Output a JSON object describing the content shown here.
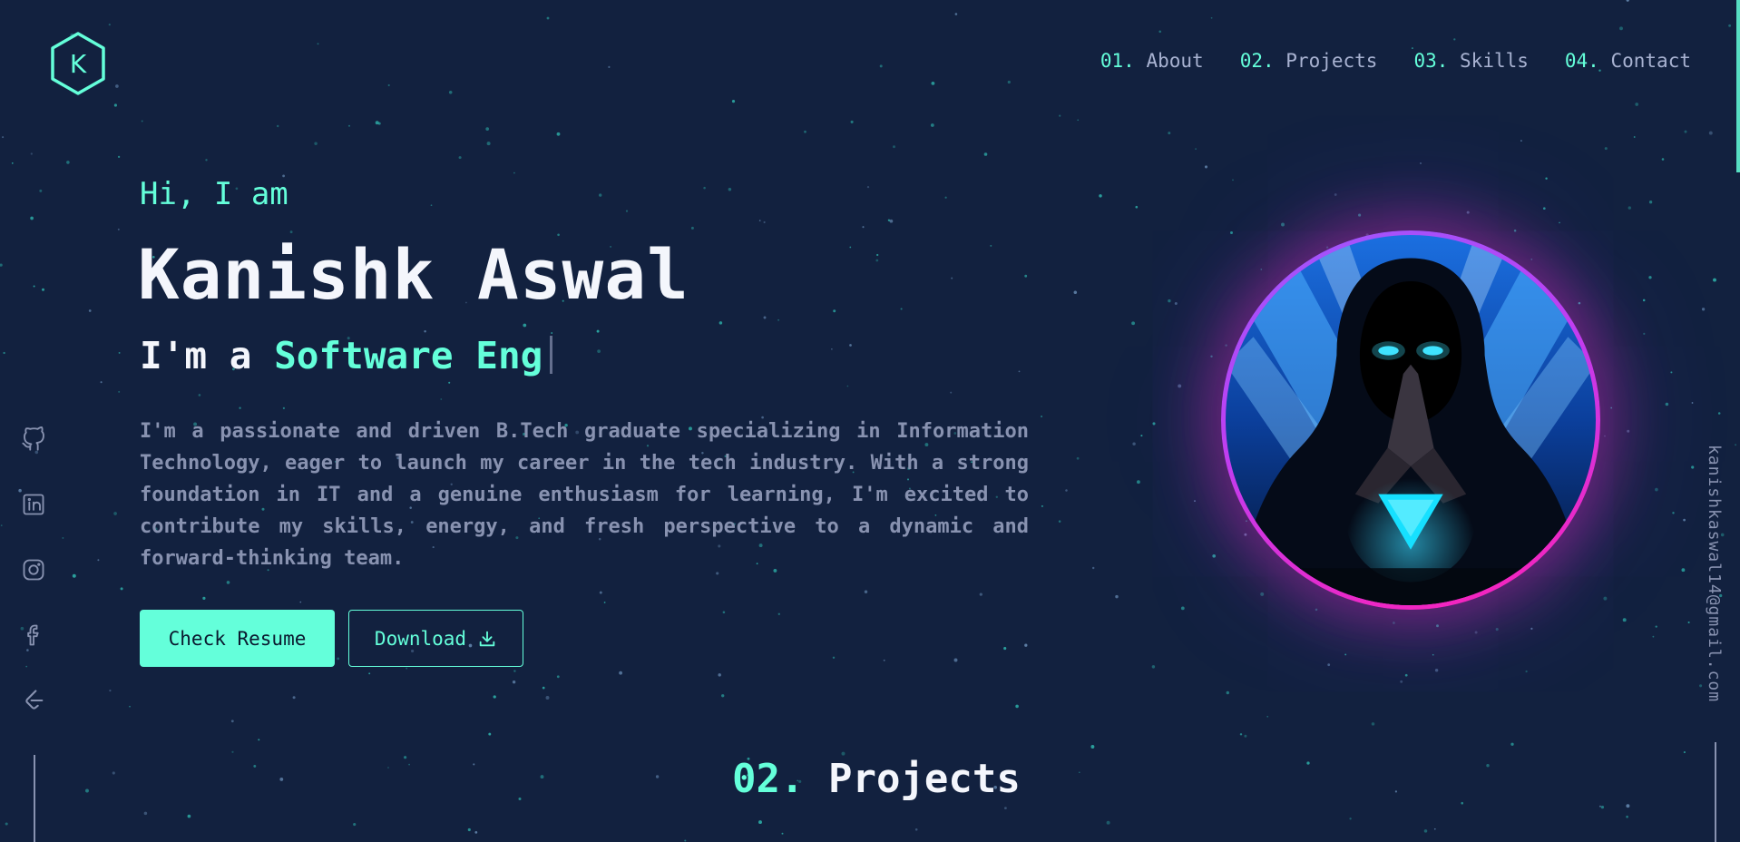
{
  "logo": {
    "letter": "K"
  },
  "nav": {
    "items": [
      {
        "num": "01.",
        "label": "About"
      },
      {
        "num": "02.",
        "label": "Projects"
      },
      {
        "num": "03.",
        "label": "Skills"
      },
      {
        "num": "04.",
        "label": "Contact"
      }
    ]
  },
  "hero": {
    "greeting": "Hi, I am",
    "name": "Kanishk Aswal",
    "role_prefix": "I'm a ",
    "role_typed": "Software Eng",
    "bio": "I'm a passionate and driven B.Tech graduate specializing in Information Technology, eager to launch my career in the tech industry. With a strong foundation in IT and a genuine enthusiasm for learning, I'm excited to contribute my skills, energy, and fresh perspective to a dynamic and forward-thinking team.",
    "primary_button": "Check Resume",
    "secondary_button": "Download"
  },
  "social": {
    "icons": [
      "github-icon",
      "linkedin-icon",
      "instagram-icon",
      "facebook-icon",
      "leetcode-icon"
    ]
  },
  "email": "kanishkaswal14@gmail.com",
  "section": {
    "num": "02.",
    "title": " Projects"
  },
  "colors": {
    "background": "#12213f",
    "accent": "#64ffda",
    "text_primary": "#f4f6fc",
    "text_secondary": "#8892b0",
    "avatar_ring_start": "#9b59ff",
    "avatar_ring_end": "#ff1fb4"
  }
}
